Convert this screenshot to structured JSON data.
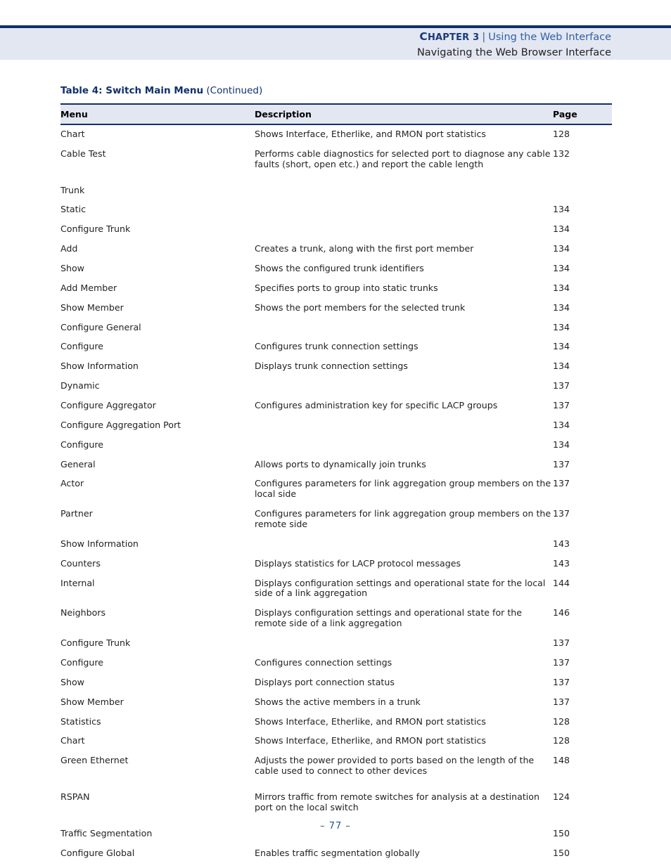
{
  "header": {
    "chapter_label_cap": "C",
    "chapter_label_rest": "HAPTER",
    "chapter_number": "3",
    "separator": "|",
    "chapter_title": "Using the Web Interface",
    "section_title": "Navigating the Web Browser Interface"
  },
  "caption": {
    "bold": "Table 4: Switch Main Menu",
    "continued": "(Continued)"
  },
  "table": {
    "columns": {
      "menu": "Menu",
      "description": "Description",
      "page": "Page"
    },
    "rows": [
      {
        "level": 1,
        "menu": "Chart",
        "description": "Shows Interface, Etherlike, and RMON port statistics",
        "page": "128",
        "gap": false
      },
      {
        "level": 1,
        "menu": "Cable Test",
        "description": "Performs cable diagnostics for selected port to diagnose any cable faults (short, open etc.) and report the cable length",
        "page": "132",
        "gap": false
      },
      {
        "level": 0,
        "menu": "Trunk",
        "description": "",
        "page": "",
        "gap": true
      },
      {
        "level": 1,
        "menu": "Static",
        "description": "",
        "page": "134",
        "gap": false
      },
      {
        "level": 2,
        "menu": "Configure Trunk",
        "description": "",
        "page": "134",
        "gap": false
      },
      {
        "level": 3,
        "menu": "Add",
        "description": "Creates a trunk, along with the first port member",
        "page": "134",
        "gap": false
      },
      {
        "level": 3,
        "menu": "Show",
        "description": "Shows the configured trunk identifiers",
        "page": "134",
        "gap": false
      },
      {
        "level": 3,
        "menu": "Add Member",
        "description": "Specifies ports to group into static trunks",
        "page": "134",
        "gap": false
      },
      {
        "level": 3,
        "menu": "Show Member",
        "description": "Shows the port members for the selected trunk",
        "page": "134",
        "gap": false
      },
      {
        "level": 2,
        "menu": "Configure General",
        "description": "",
        "page": "134",
        "gap": false
      },
      {
        "level": 3,
        "menu": "Configure",
        "description": "Configures trunk connection settings",
        "page": "134",
        "gap": false
      },
      {
        "level": 3,
        "menu": "Show Information",
        "description": "Displays trunk connection settings",
        "page": "134",
        "gap": false
      },
      {
        "level": 1,
        "menu": "Dynamic",
        "description": "",
        "page": "137",
        "gap": false
      },
      {
        "level": 2,
        "menu": "Configure Aggregator",
        "description": "Configures administration key for specific LACP groups",
        "page": "137",
        "gap": false
      },
      {
        "level": 2,
        "menu": "Configure Aggregation Port",
        "description": "",
        "page": "134",
        "gap": false
      },
      {
        "level": 3,
        "menu": "Configure",
        "description": "",
        "page": "134",
        "gap": false
      },
      {
        "level": 4,
        "menu": "General",
        "description": "Allows ports to dynamically join trunks",
        "page": "137",
        "gap": false
      },
      {
        "level": 4,
        "menu": "Actor",
        "description": "Configures parameters for link aggregation group members on the local side",
        "page": "137",
        "gap": false
      },
      {
        "level": 4,
        "menu": "Partner",
        "description": "Configures parameters for link aggregation group members on the remote side",
        "page": "137",
        "gap": false
      },
      {
        "level": 3,
        "menu": "Show Information",
        "description": "",
        "page": "143",
        "gap": false
      },
      {
        "level": 4,
        "menu": "Counters",
        "description": "Displays statistics for LACP protocol messages",
        "page": "143",
        "gap": false
      },
      {
        "level": 4,
        "menu": "Internal",
        "description": "Displays configuration settings and operational state for the local side of a link aggregation",
        "page": "144",
        "gap": false
      },
      {
        "level": 4,
        "menu": "Neighbors",
        "description": "Displays configuration settings and operational state for the remote side of a link aggregation",
        "page": "146",
        "gap": false
      },
      {
        "level": 2,
        "menu": "Configure Trunk",
        "description": "",
        "page": "137",
        "gap": false
      },
      {
        "level": 3,
        "menu": "Configure",
        "description": "Configures connection settings",
        "page": "137",
        "gap": false
      },
      {
        "level": 3,
        "menu": "Show",
        "description": "Displays port connection status",
        "page": "137",
        "gap": false
      },
      {
        "level": 3,
        "menu": "Show Member",
        "description": "Shows the active members in a trunk",
        "page": "137",
        "gap": false
      },
      {
        "level": 1,
        "menu": "Statistics",
        "description": "Shows Interface, Etherlike, and RMON port statistics",
        "page": "128",
        "gap": false
      },
      {
        "level": 1,
        "menu": "Chart",
        "description": "Shows Interface, Etherlike, and RMON port statistics",
        "page": "128",
        "gap": false
      },
      {
        "level": 0,
        "menu": "Green Ethernet",
        "description": "Adjusts the power provided to ports based on the length of the cable used to connect to other devices",
        "page": "148",
        "gap": false
      },
      {
        "level": 0,
        "menu": "RSPAN",
        "description": "Mirrors traffic from remote switches for analysis at a destination port on the local switch",
        "page": "124",
        "gap": true
      },
      {
        "level": 0,
        "menu": "Traffic Segmentation",
        "description": "",
        "page": "150",
        "gap": true
      },
      {
        "level": 1,
        "menu": "Configure Global",
        "description": "Enables traffic segmentation globally",
        "page": "150",
        "gap": false
      }
    ]
  },
  "footer": {
    "page_marker": "–  77  –"
  }
}
